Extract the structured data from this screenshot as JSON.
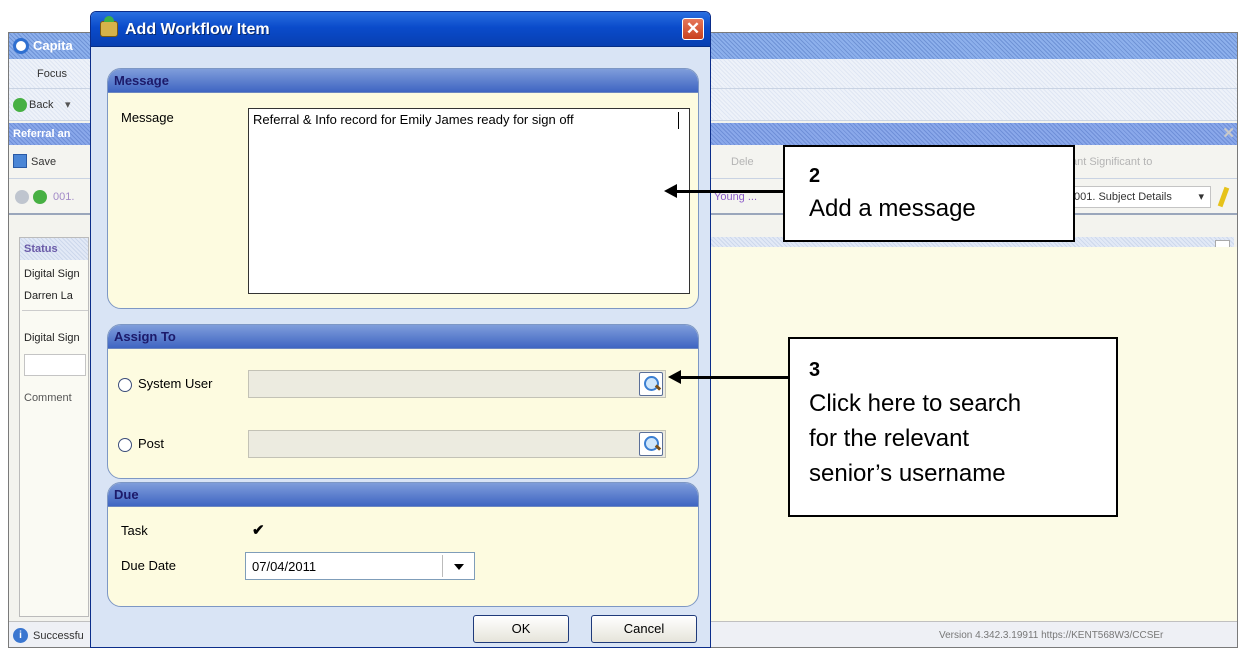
{
  "background_app": {
    "title": "Capita",
    "menu_focus": "Focus",
    "nav_back": "Back",
    "doc_title": "Referral an",
    "save_label": "Save",
    "toolbar_delete": "Dele",
    "toolbar_significant": "ant  Significant to",
    "record_code": "001.",
    "person_tag": "Young ...",
    "subject_details": "001. Subject Details",
    "status_header": "Status",
    "status_rows": [
      "Digital Sign",
      "Darren La",
      "Digital Sign",
      "Comment"
    ],
    "status_bar_text": "Successfu",
    "version_text": "Version 4.342.3.19911  https://KENT568W3/CCSEr"
  },
  "dialog": {
    "title": "Add Workflow Item",
    "close_glyph": "✕",
    "message_group": {
      "heading": "Message",
      "label": "Message",
      "value": "Referral & Info record for Emily  James ready for sign off"
    },
    "assign_group": {
      "heading": "Assign To",
      "option_system_user": "System User",
      "option_post": "Post",
      "system_user_value": "",
      "post_value": ""
    },
    "due_group": {
      "heading": "Due",
      "task_label": "Task",
      "task_checked_glyph": "✔",
      "due_date_label": "Due Date",
      "due_date_value": "07/04/2011"
    },
    "ok_label": "OK",
    "cancel_label": "Cancel"
  },
  "callouts": {
    "step2_number": "2",
    "step2_text": "Add a message",
    "step3_number": "3",
    "step3_line1": "Click here to search",
    "step3_line2": "for the relevant",
    "step3_line3": "senior’s username"
  },
  "icons": [
    "workflow-icon",
    "close-icon",
    "search-icon",
    "checkmark-icon",
    "dropdown-arrow-icon",
    "info-icon",
    "save-icon",
    "back-icon"
  ],
  "colors": {
    "titlebar_blue": "#0a4bcb",
    "group_header": "#3f65c2",
    "panel_yellow": "#fdfbe0",
    "close_red": "#c9401d"
  }
}
